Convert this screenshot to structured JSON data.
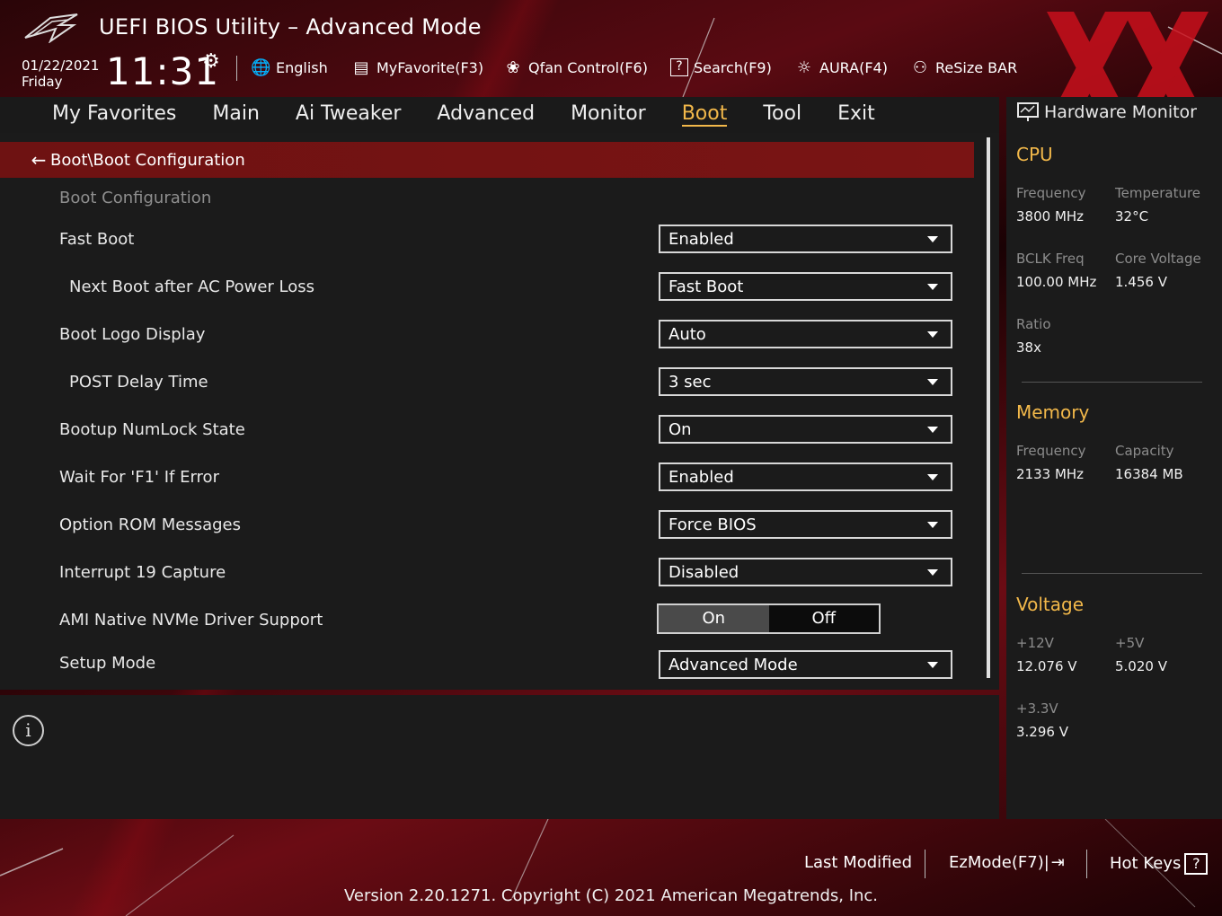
{
  "header": {
    "title": "UEFI BIOS Utility – Advanced Mode",
    "date": "01/22/2021",
    "day": "Friday",
    "time": "11:31",
    "toolbar": [
      {
        "label": "English",
        "icon": "globe-icon"
      },
      {
        "label": "MyFavorite(F3)",
        "icon": "favorites-list-icon"
      },
      {
        "label": "Qfan Control(F6)",
        "icon": "fan-icon"
      },
      {
        "label": "Search(F9)",
        "icon": "search-help-icon"
      },
      {
        "label": "AURA(F4)",
        "icon": "aura-light-icon"
      },
      {
        "label": "ReSize BAR",
        "icon": "resize-bar-icon"
      }
    ]
  },
  "tabs": [
    "My Favorites",
    "Main",
    "Ai Tweaker",
    "Advanced",
    "Monitor",
    "Boot",
    "Tool",
    "Exit"
  ],
  "active_tab": "Boot",
  "main": {
    "breadcrumb": "Boot\\Boot Configuration",
    "section_title": "Boot Configuration",
    "settings": [
      {
        "label": "Fast Boot",
        "value": "Enabled"
      },
      {
        "label": "Next Boot after AC Power Loss",
        "value": "Fast Boot"
      },
      {
        "label": "Boot Logo Display",
        "value": "Auto"
      },
      {
        "label": "POST Delay Time",
        "value": "3 sec"
      },
      {
        "label": "Bootup NumLock State",
        "value": "On"
      },
      {
        "label": "Wait For 'F1' If Error",
        "value": "Enabled"
      },
      {
        "label": "Option ROM Messages",
        "value": "Force BIOS"
      },
      {
        "label": "Interrupt 19 Capture",
        "value": "Disabled"
      },
      {
        "label": "AMI Native NVMe Driver Support",
        "on": "On",
        "off": "Off",
        "selected": "On"
      },
      {
        "label": "Setup Mode",
        "value": "Advanced Mode"
      }
    ]
  },
  "hw_monitor": {
    "title": "Hardware Monitor",
    "cpu": {
      "heading": "CPU",
      "frequency_label": "Frequency",
      "frequency": "3800 MHz",
      "temperature_label": "Temperature",
      "temperature": "32°C",
      "bclk_label": "BCLK Freq",
      "bclk": "100.00 MHz",
      "core_voltage_label": "Core Voltage",
      "core_voltage": "1.456 V",
      "ratio_label": "Ratio",
      "ratio": "38x"
    },
    "memory": {
      "heading": "Memory",
      "frequency_label": "Frequency",
      "frequency": "2133 MHz",
      "capacity_label": "Capacity",
      "capacity": "16384 MB"
    },
    "voltage": {
      "heading": "Voltage",
      "v12_label": "+12V",
      "v12": "12.076 V",
      "v5_label": "+5V",
      "v5": "5.020 V",
      "v33_label": "+3.3V",
      "v33": "3.296 V"
    }
  },
  "footer": {
    "last_modified": "Last Modified",
    "ezmode": "EzMode(F7)|",
    "hotkeys": "Hot Keys",
    "hotkeys_key": "?",
    "version": "Version 2.20.1271. Copyright (C) 2021 American Megatrends, Inc."
  },
  "colors": {
    "accent": "#f2b84a",
    "breadcrumb_bar": "#7a1414",
    "panel": "#1b1b1b"
  }
}
